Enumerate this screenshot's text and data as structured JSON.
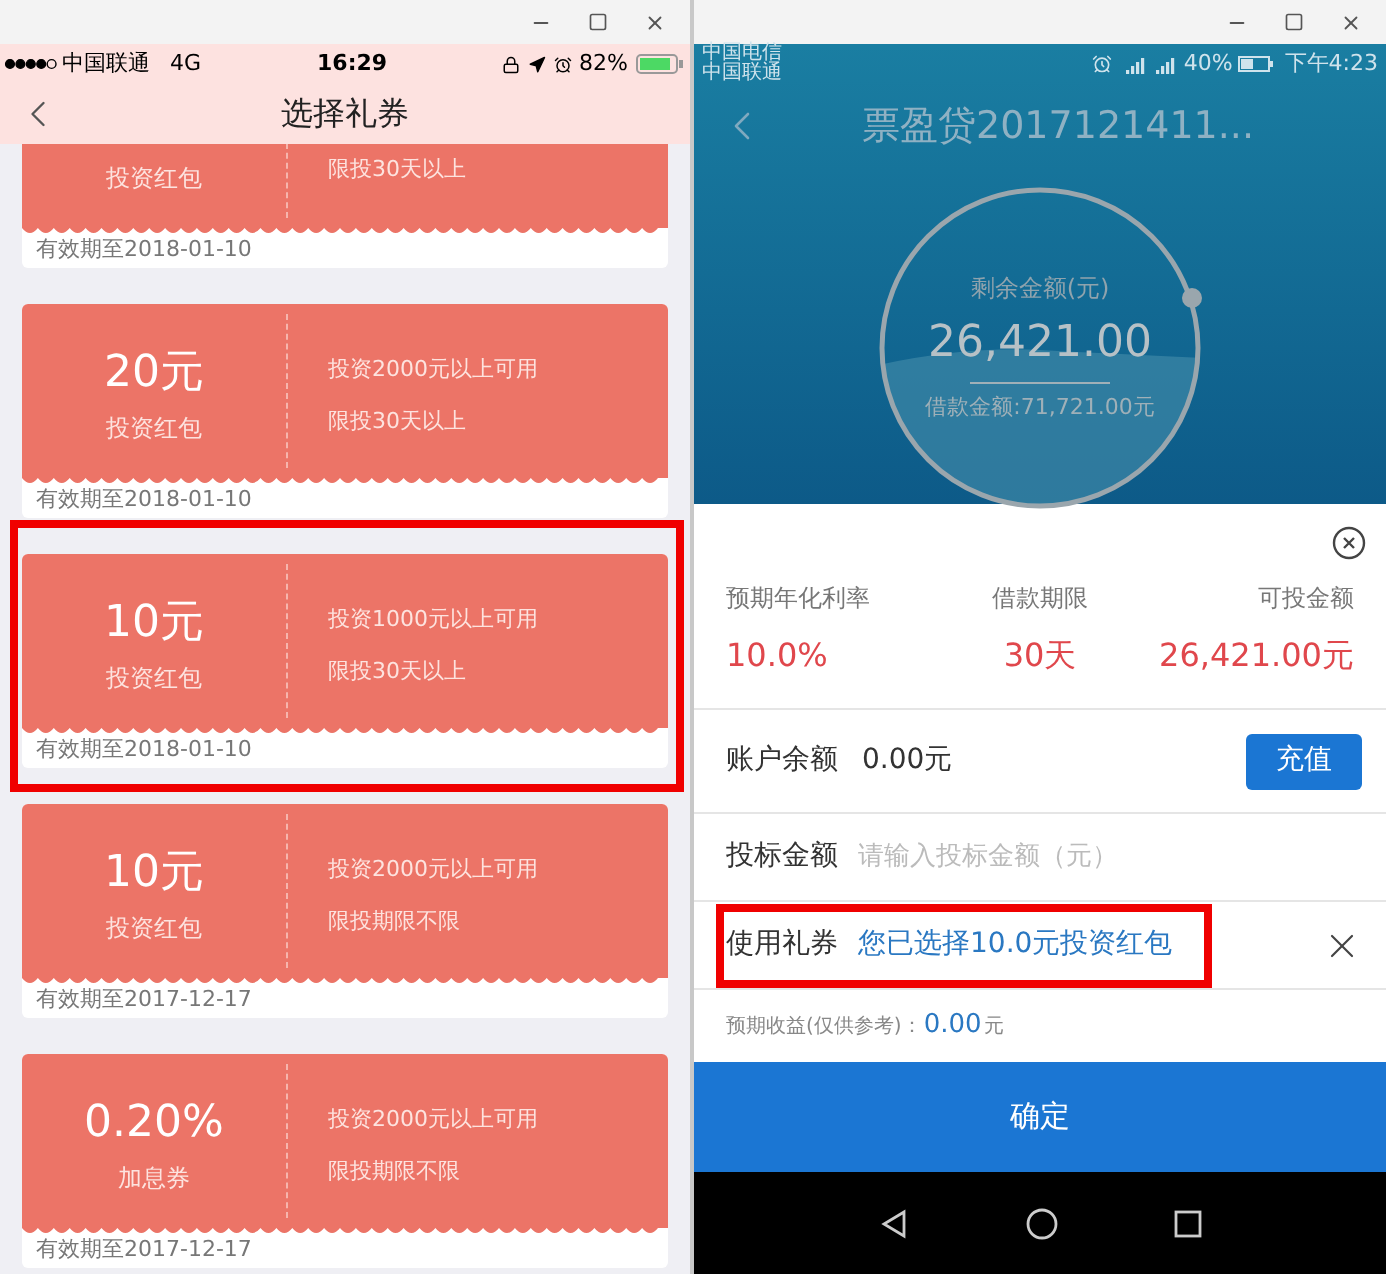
{
  "left_window": {
    "status_bar": {
      "carrier": "中国联通",
      "network": "4G",
      "time": "16:29",
      "battery": "82%"
    },
    "nav": {
      "title": "选择礼券"
    },
    "coupons": [
      {
        "type": "投资红包",
        "term": "限投30天以上",
        "expiry": "有效期至2018-01-10",
        "highlighted": false
      },
      {
        "amount": "20元",
        "type": "投资红包",
        "condition": "投资2000元以上可用",
        "term": "限投30天以上",
        "expiry": "有效期至2018-01-10",
        "highlighted": false
      },
      {
        "amount": "10元",
        "type": "投资红包",
        "condition": "投资1000元以上可用",
        "term": "限投30天以上",
        "expiry": "有效期至2018-01-10",
        "highlighted": true
      },
      {
        "amount": "10元",
        "type": "投资红包",
        "condition": "投资2000元以上可用",
        "term": "限投期限不限",
        "expiry": "有效期至2017-12-17",
        "highlighted": false
      },
      {
        "amount": "0.20%",
        "type": "加息券",
        "condition": "投资2000元以上可用",
        "term": "限投期限不限",
        "expiry": "有效期至2017-12-17",
        "highlighted": false
      }
    ]
  },
  "right_window": {
    "status_bar": {
      "carriers": [
        "中国电信",
        "中国联通"
      ],
      "battery": "40%",
      "time": "下午4:23"
    },
    "header": {
      "title": "票盈贷2017121411...",
      "gauge_label": "剩余金额(元)",
      "gauge_value": "26,421.00",
      "loan": "借款金额:71,721.00元"
    },
    "stats": [
      {
        "label": "预期年化利率",
        "value": "10.0%"
      },
      {
        "label": "借款期限",
        "value": "30天"
      },
      {
        "label": "可投金额",
        "value": "26,421.00元"
      }
    ],
    "balance": {
      "label": "账户余额",
      "value": "0.00元",
      "button": "充值"
    },
    "bid_amount": {
      "label": "投标金额",
      "placeholder": "请输入投标金额（元）"
    },
    "coupon_row": {
      "label": "使用礼券",
      "value": "您已选择10.0元投资红包",
      "highlighted": true
    },
    "expected_return": {
      "label": "预期收益(仅供参考)：",
      "value": "0.00",
      "unit": "元"
    },
    "confirm_button": "确定"
  }
}
